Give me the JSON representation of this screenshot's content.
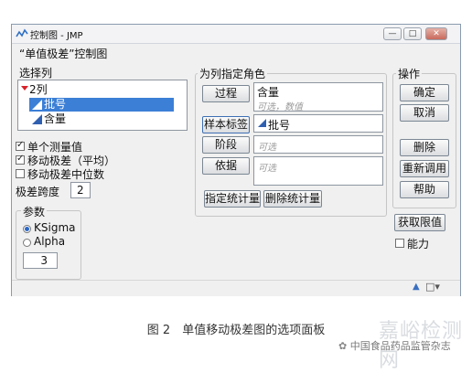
{
  "window": {
    "title": "控制图 - JMP",
    "subtitle": "“单值极差”控制图"
  },
  "select_columns": {
    "group_label": "选择列",
    "count_label": "2列",
    "columns": [
      {
        "name": "批号",
        "selected": true
      },
      {
        "name": "含量",
        "selected": false
      }
    ]
  },
  "options": {
    "single_measure": {
      "label": "单个测量值",
      "checked": true
    },
    "moving_range_avg": {
      "label": "移动极差（平均）",
      "checked": true
    },
    "moving_range_median": {
      "label": "移动极差中位数",
      "checked": false
    },
    "range_span": {
      "label": "极差跨度",
      "value": "2"
    }
  },
  "params": {
    "group_label": "参数",
    "radios": [
      {
        "label": "KSigma",
        "selected": true
      },
      {
        "label": "Alpha",
        "selected": false
      }
    ],
    "value": "3"
  },
  "roles": {
    "group_label": "为列指定角色",
    "process": {
      "button": "过程",
      "value": "含量",
      "hint": "可选，数值"
    },
    "sample_label": {
      "button": "样本标签",
      "value": "批号"
    },
    "phase": {
      "button": "阶段",
      "hint": "可选"
    },
    "by": {
      "button": "依据",
      "hint": "可选"
    },
    "specify_stat_button": "指定统计量",
    "delete_stat_button": "删除统计量"
  },
  "actions": {
    "group_label": "操作",
    "ok": "确定",
    "cancel": "取消",
    "remove": "删除",
    "recall": "重新调用",
    "help": "帮助",
    "get_limits": "获取限值",
    "capability": {
      "label": "能力",
      "checked": false
    }
  },
  "caption": "图 2　单值移动极差图的选项面板",
  "watermark": {
    "big": "嘉峪检测网",
    "small": "中国食品药品监管杂志"
  },
  "colors": {
    "selection": "#3b7fd6",
    "triangle": "#2f5fb0",
    "caret": "#d8222a"
  }
}
